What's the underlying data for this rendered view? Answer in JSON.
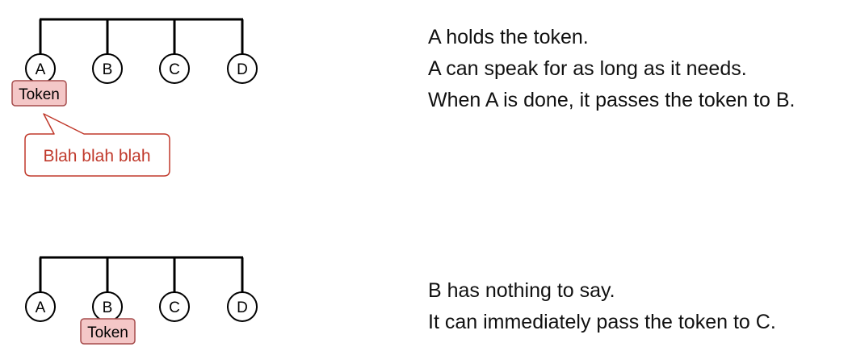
{
  "colors": {
    "line": "#000000",
    "token_fill": "#f4c7c7",
    "token_stroke": "#a64d4d",
    "bubble_stroke": "#c0392b",
    "bubble_text": "#c0392b"
  },
  "scenario1": {
    "nodes": [
      "A",
      "B",
      "C",
      "D"
    ],
    "token_label": "Token",
    "speech": "Blah blah blah",
    "lines": [
      "A holds the token.",
      "A can speak for as long as it needs.",
      "When A is done, it passes the token to B."
    ]
  },
  "scenario2": {
    "nodes": [
      "A",
      "B",
      "C",
      "D"
    ],
    "token_label": "Token",
    "lines": [
      "B has nothing to say.",
      "It can immediately pass the token to C."
    ]
  }
}
